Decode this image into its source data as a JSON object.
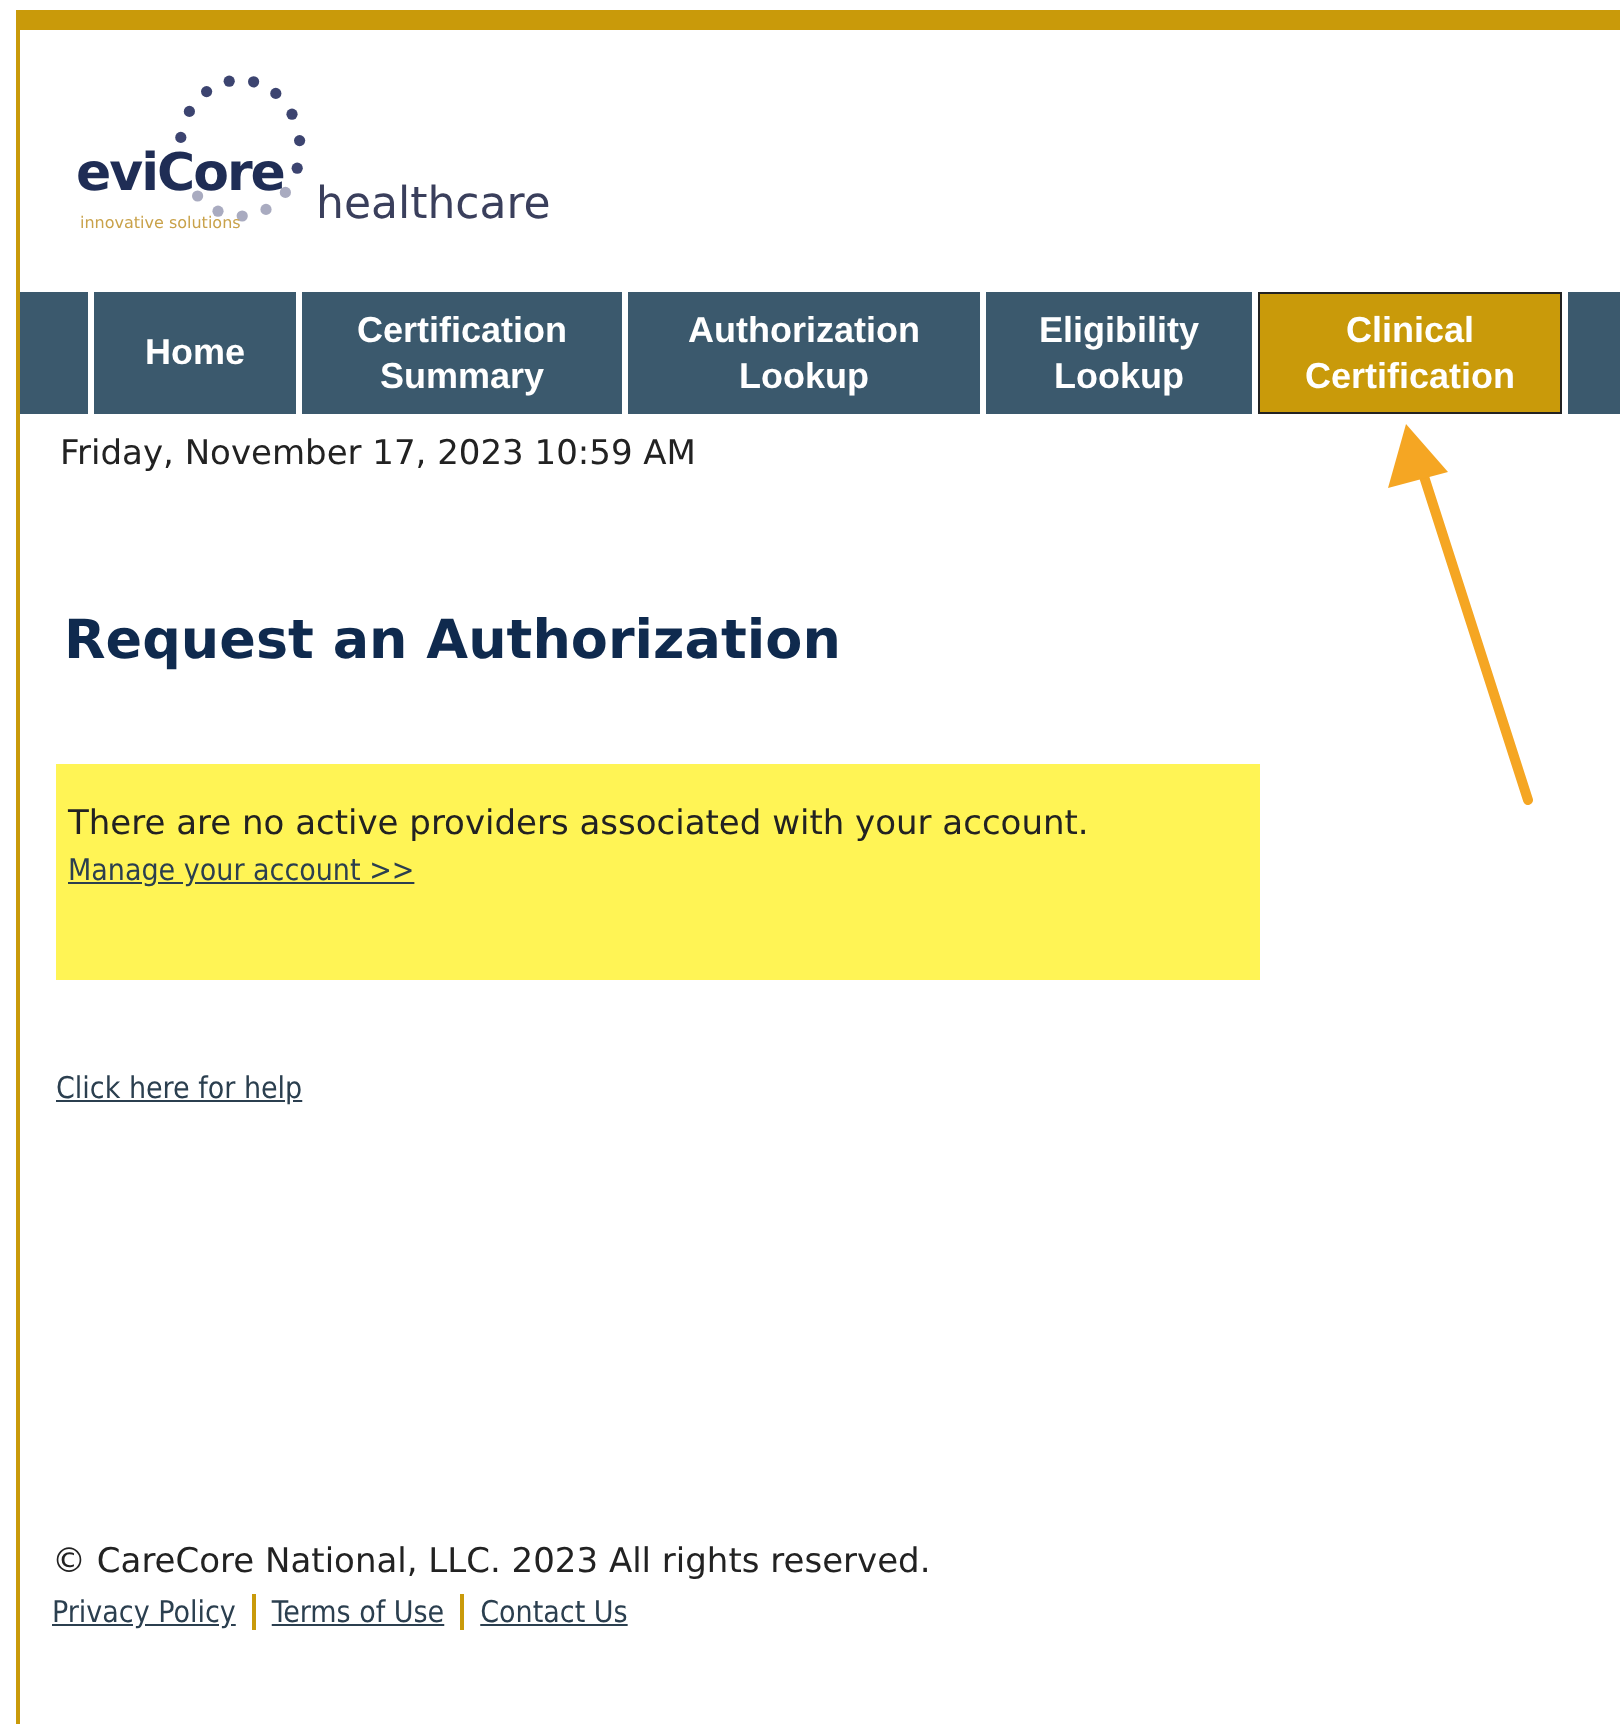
{
  "logo": {
    "brand": "eviCore",
    "tagline": "innovative solutions",
    "suffix": "healthcare"
  },
  "nav": [
    {
      "label": "Home",
      "selected": false
    },
    {
      "label": "Certification Summary",
      "selected": false
    },
    {
      "label": "Authorization Lookup",
      "selected": false
    },
    {
      "label": "Eligibility Lookup",
      "selected": false
    },
    {
      "label": "Clinical Certification",
      "selected": true
    }
  ],
  "datetime": "Friday, November 17, 2023 10:59 AM",
  "heading": "Request an Authorization",
  "notice": {
    "message": "There are no active providers associated with your account.",
    "link": "Manage your account >>"
  },
  "help_link": "Click here for help",
  "footer": {
    "copyright": "© CareCore National, LLC. 2023 All rights reserved.",
    "links": [
      "Privacy Policy",
      "Terms of Use",
      "Contact Us"
    ]
  }
}
